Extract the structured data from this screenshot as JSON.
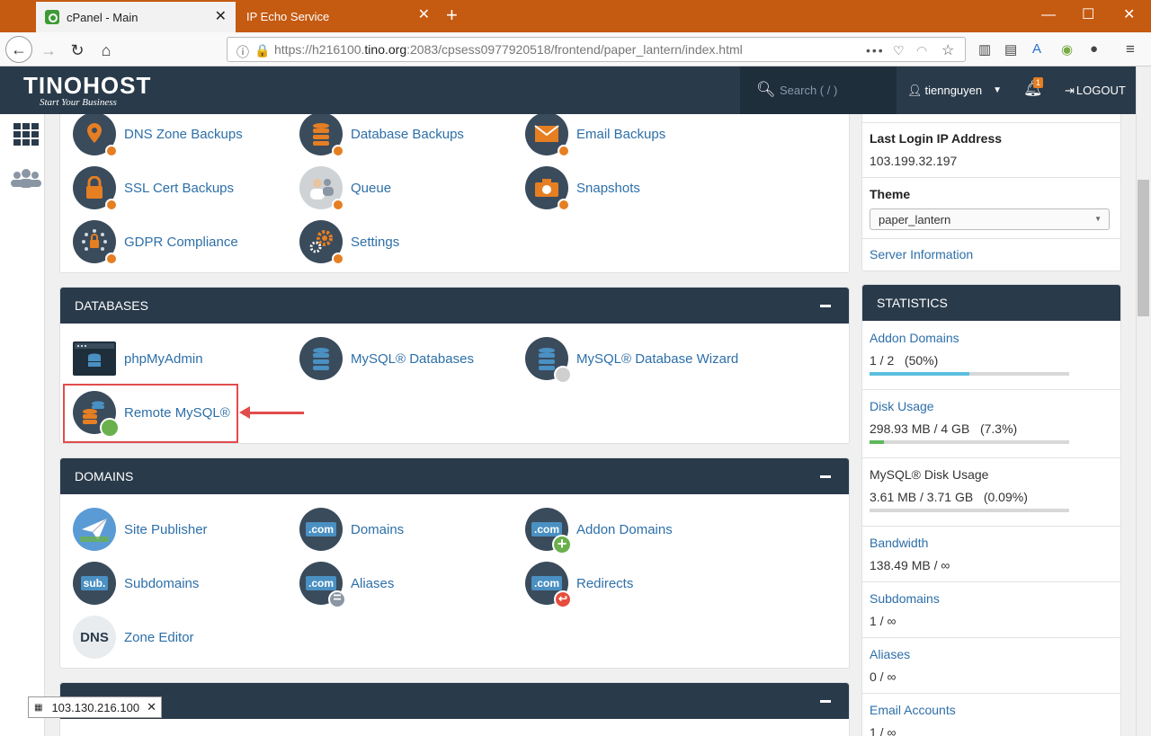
{
  "browser": {
    "tabs": [
      {
        "label": "cPanel - Main"
      },
      {
        "label": "IP Echo Service"
      }
    ],
    "url": {
      "prefix": "https://h216100.",
      "host": "tino.org",
      "suffix": ":2083/cpsess0977920518/frontend/paper_lantern/index.html"
    },
    "status_ip": "103.130.216.100"
  },
  "header": {
    "logo": "TINOHOST",
    "slogan": "Start Your Business",
    "search_placeholder": "Search ( / )",
    "username": "tiennguyen",
    "notification_count": "1",
    "logout_label": "LOGOUT"
  },
  "files_section": {
    "items": [
      {
        "label": "DNS Zone Backups"
      },
      {
        "label": "Database Backups"
      },
      {
        "label": "Email Backups"
      },
      {
        "label": "SSL Cert Backups"
      },
      {
        "label": "Queue"
      },
      {
        "label": "Snapshots"
      },
      {
        "label": "GDPR Compliance"
      },
      {
        "label": "Settings"
      }
    ]
  },
  "databases": {
    "title": "DATABASES",
    "items": [
      {
        "label": "phpMyAdmin"
      },
      {
        "label": "MySQL® Databases"
      },
      {
        "label": "MySQL® Database Wizard"
      },
      {
        "label": "Remote MySQL®"
      }
    ]
  },
  "domains": {
    "title": "DOMAINS",
    "items": [
      {
        "label": "Site Publisher"
      },
      {
        "label": "Domains"
      },
      {
        "label": "Addon Domains"
      },
      {
        "label": "Subdomains"
      },
      {
        "label": "Aliases"
      },
      {
        "label": "Redirects"
      },
      {
        "label": "Zone Editor"
      }
    ],
    "icon_text": {
      "com": ".com",
      "sub": "sub.",
      "dns": "DNS"
    }
  },
  "general_info": {
    "last_login_label": "Last Login IP Address",
    "last_login_value": "103.199.32.197",
    "theme_label": "Theme",
    "theme_value": "paper_lantern",
    "server_info_link": "Server Information"
  },
  "statistics": {
    "title": "STATISTICS",
    "rows": [
      {
        "label": "Addon Domains",
        "value": "1 / 2",
        "percent_text": "(50%)",
        "percent": 50,
        "color": "#5bc0de"
      },
      {
        "label": "Disk Usage",
        "value": "298.93 MB / 4 GB",
        "percent_text": "(7.3%)",
        "percent": 7.3,
        "color": "#5cb85c"
      },
      {
        "label": "MySQL® Disk Usage",
        "value": "3.61 MB / 3.71 GB",
        "percent_text": "(0.09%)",
        "percent": 0.09,
        "color": "#5cb85c"
      },
      {
        "label": "Bandwidth",
        "value": "138.49 MB / ∞"
      },
      {
        "label": "Subdomains",
        "value": "1 / ∞"
      },
      {
        "label": "Aliases",
        "value": "0 / ∞"
      },
      {
        "label": "Email Accounts",
        "value": "1 / ∞"
      }
    ]
  },
  "colors": {
    "header_bg": "#293a4a",
    "link": "#2d6fa8",
    "tab_strip": "#c55a11",
    "highlight": "#e24b4b"
  }
}
